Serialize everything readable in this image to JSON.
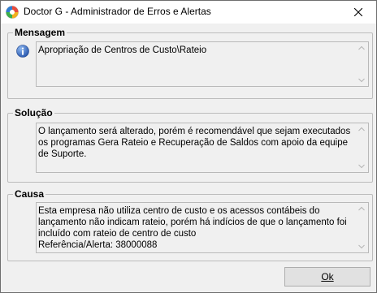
{
  "window": {
    "title": "Doctor G - Administrador de Erros e Alertas",
    "icon": "doctor-g-app-icon",
    "close_icon": "close-icon"
  },
  "mensagem": {
    "label": "Mensagem",
    "icon": "info-icon",
    "text": "Apropriação de Centros de Custo\\Rateio"
  },
  "solucao": {
    "label": "Solução",
    "text": "O lançamento será alterado, porém é recomendável que sejam executados os programas Gera Rateio e Recuperação de Saldos com apoio da equipe de Suporte."
  },
  "causa": {
    "label": "Causa",
    "text": "Esta empresa não utiliza centro de custo e os acessos contábeis do lançamento não indicam rateio, porém há indícios de que o lançamento foi incluído com rateio de centro de custo\nReferência/Alerta: 38000088"
  },
  "buttons": {
    "ok_label": "Ok"
  },
  "colors": {
    "window_bg": "#f0f0f0",
    "border": "#bcbcbc",
    "info_blue": "#2a5fb8"
  }
}
